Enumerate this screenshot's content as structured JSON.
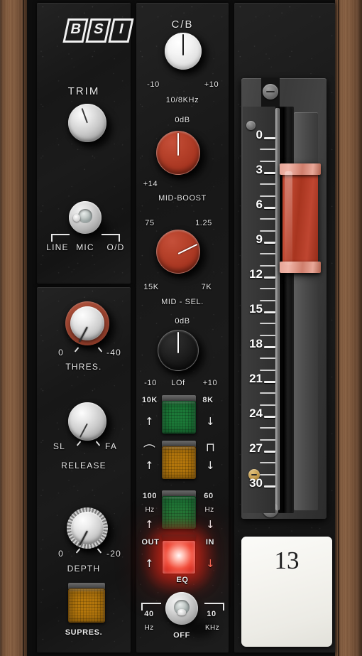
{
  "brand": {
    "logo_letters": [
      "B",
      "S",
      "I"
    ]
  },
  "input_module": {
    "trim": {
      "label": "TRIM",
      "type": "knob-silver"
    },
    "source_switch": {
      "positions": [
        "LINE",
        "MIC",
        "O/D"
      ],
      "selected": "MIC"
    }
  },
  "dynamics_module": {
    "threshold": {
      "label": "THRES.",
      "min_label": "0",
      "max_label": "-40"
    },
    "release": {
      "label": "RELEASE",
      "min_label": "SL",
      "max_label": "FA"
    },
    "depth": {
      "label": "DEPTH",
      "min_label": "0",
      "max_label": "-20"
    },
    "suppress_button": {
      "label": "SUPRES.",
      "color": "#b5770c",
      "state": "dim"
    }
  },
  "eq_module": {
    "hf": {
      "top_label": "C/B",
      "left_label": "-10",
      "right_label": "+10",
      "freq_label": "10/8KHz"
    },
    "mid_boost": {
      "top_label": "0dB",
      "left_label": "+14",
      "name_label": "MID-BOOST"
    },
    "mid_sel": {
      "upper_left": "75",
      "upper_right": "1.25",
      "lower_left": "15K",
      "lower_right": "7K",
      "name_label": "MID - SEL."
    },
    "lf": {
      "top_label": "0dB",
      "left_label": "-10",
      "center_label": "LOf",
      "right_label": "+10"
    },
    "buttons": [
      {
        "left_label": "10K",
        "right_label": "8K",
        "left_arrow": "↑",
        "right_arrow": "↓",
        "color": "#1c7a38",
        "state": "dim",
        "name": "hf-freq-button"
      },
      {
        "left_label": "⌒",
        "right_label": "⊓",
        "left_arrow": "↑",
        "right_arrow": "↓",
        "color": "#b5770c",
        "state": "dim",
        "name": "hf-shape-button"
      },
      {
        "left_label": "100",
        "left_label2": "Hz",
        "right_label": "60",
        "right_label2": "Hz",
        "left_arrow": "↑",
        "right_arrow": "↓",
        "color": "#1c7a38",
        "state": "dim",
        "name": "lf-freq-button"
      },
      {
        "left_label": "OUT",
        "right_label": "IN",
        "left_arrow": "↑",
        "right_arrow": "↓",
        "color": "#e8281c",
        "state": "lit",
        "caption": "EQ",
        "name": "eq-in-out-button"
      }
    ],
    "filter_switch": {
      "left_label": "40",
      "left_label2": "Hz",
      "center_label": "OFF",
      "right_label": "10",
      "right_label2": "KHz",
      "selected": "OFF"
    }
  },
  "fader_module": {
    "scale_numbers": [
      "0",
      "3",
      "6",
      "9",
      "12",
      "15",
      "18",
      "21",
      "24",
      "27",
      "30"
    ],
    "scale_unit": "dB",
    "fader_position_db": 8,
    "channel_number": "13"
  },
  "colors": {
    "panel": "#151515",
    "wood": "#7a5438",
    "red_knob": "#a93722",
    "lamp_red": "#e8281c",
    "lamp_green": "#1c7a38",
    "lamp_amber": "#b5770c"
  }
}
